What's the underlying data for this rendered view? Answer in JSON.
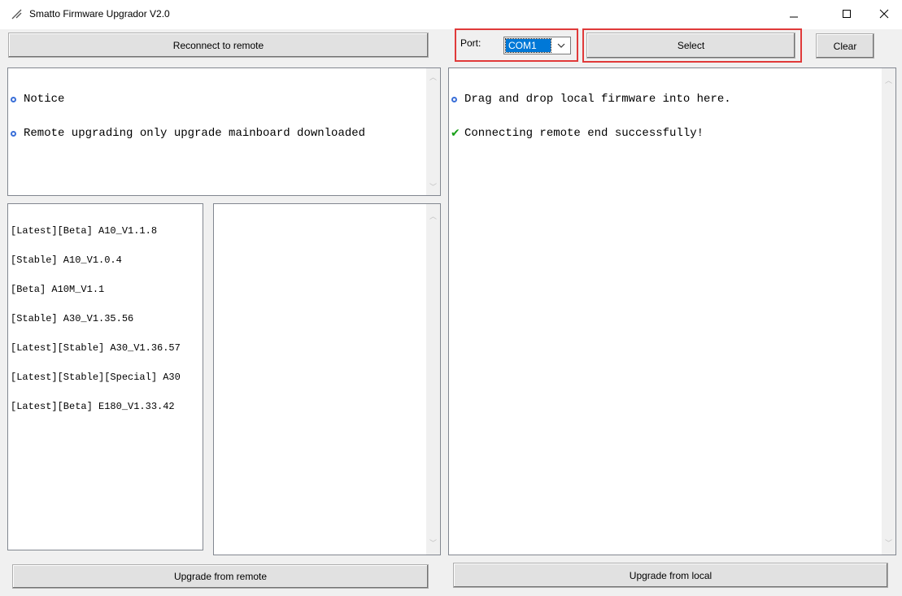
{
  "window": {
    "title": "Smatto Firmware Upgrador V2.0",
    "controls": {
      "minimize": "—",
      "maximize": "☐",
      "close": "✕"
    }
  },
  "left": {
    "reconnect_label": "Reconnect to remote",
    "notice_log": [
      {
        "icon": "bullet-icon",
        "text": "Notice"
      },
      {
        "icon": "bullet-icon",
        "text": "Remote upgrading only upgrade mainboard downloaded"
      }
    ],
    "firmware_list": [
      "[Latest][Beta] A10_V1.1.8",
      "[Stable] A10_V1.0.4",
      "[Beta] A10M_V1.1",
      "[Stable] A30_V1.35.56",
      "[Latest][Stable] A30_V1.36.57",
      "[Latest][Stable][Special] A30",
      "[Latest][Beta] E180_V1.33.42"
    ],
    "upgrade_label": "Upgrade from remote"
  },
  "right": {
    "port_label": "Port:",
    "port_value": "COM1",
    "select_label": "Select",
    "clear_label": "Clear",
    "log": [
      {
        "icon": "bullet-icon",
        "text": "Drag and drop local firmware into here."
      },
      {
        "icon": "check-icon",
        "text": "Connecting remote end successfully!"
      }
    ],
    "upgrade_label": "Upgrade from local"
  },
  "colors": {
    "highlight": "#e03a3a",
    "selection": "#0078d7",
    "bullet": "#3a6fd8",
    "check": "#19a019"
  }
}
